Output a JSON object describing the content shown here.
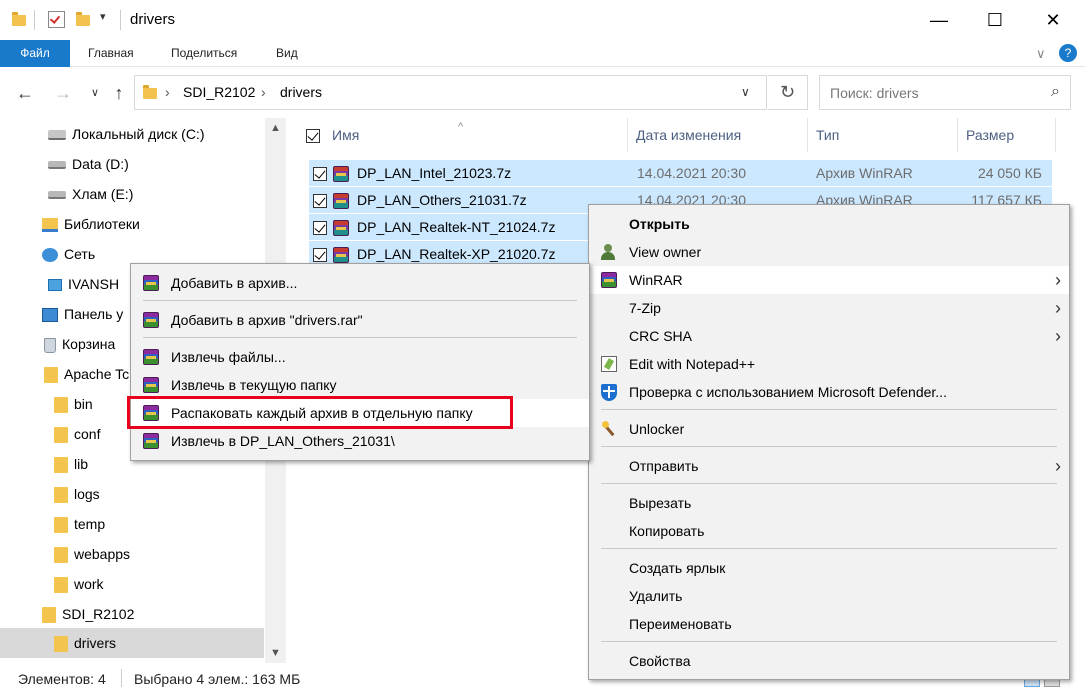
{
  "window": {
    "title": "drivers",
    "minimize_glyph": "—",
    "maximize_glyph": "☐",
    "close_glyph": "✕"
  },
  "ribbon": {
    "tabs": [
      "Файл",
      "Главная",
      "Поделиться",
      "Вид"
    ],
    "help_glyph": "?"
  },
  "address": {
    "crumbs": [
      "SDI_R2102",
      "drivers"
    ],
    "search_placeholder": "Поиск: drivers"
  },
  "nav_pane": {
    "items": [
      {
        "label": "Локальный диск (C:)",
        "icon": "drive-icon"
      },
      {
        "label": "Data (D:)",
        "icon": "drive-icon"
      },
      {
        "label": "Хлам (E:)",
        "icon": "drive-icon"
      },
      {
        "label": "Библиотеки",
        "icon": "library-icon"
      },
      {
        "label": "Сеть",
        "icon": "network-icon"
      },
      {
        "label": "IVANSH",
        "icon": "computer-icon"
      },
      {
        "label": "Панель у",
        "icon": "control-panel-icon"
      },
      {
        "label": "Корзина",
        "icon": "recycle-bin-icon"
      },
      {
        "label": "Apache Tc",
        "icon": "folder-icon"
      },
      {
        "label": "bin",
        "icon": "folder-icon"
      },
      {
        "label": "conf",
        "icon": "folder-icon"
      },
      {
        "label": "lib",
        "icon": "folder-icon"
      },
      {
        "label": "logs",
        "icon": "folder-icon"
      },
      {
        "label": "temp",
        "icon": "folder-icon"
      },
      {
        "label": "webapps",
        "icon": "folder-icon"
      },
      {
        "label": "work",
        "icon": "folder-icon"
      },
      {
        "label": "SDI_R2102",
        "icon": "folder-icon"
      },
      {
        "label": "drivers",
        "icon": "folder-icon",
        "selected": true
      }
    ]
  },
  "file_list": {
    "columns": [
      "Имя",
      "Дата изменения",
      "Тип",
      "Размер"
    ],
    "files": [
      {
        "name": "DP_LAN_Intel_21023.7z",
        "date": "14.04.2021 20:30",
        "type": "Архив WinRAR",
        "size": "24 050 КБ"
      },
      {
        "name": "DP_LAN_Others_21031.7z",
        "date": "14.04.2021 20:30",
        "type": "Архив WinRAR",
        "size": "117 657 КБ"
      },
      {
        "name": "DP_LAN_Realtek-NT_21024.7z",
        "date": "",
        "type": "",
        "size": ""
      },
      {
        "name": "DP_LAN_Realtek-XP_21020.7z",
        "date": "",
        "type": "",
        "size": ""
      }
    ]
  },
  "status": {
    "items_count": "Элементов: 4",
    "selected": "Выбрано 4 элем.: 163 МБ"
  },
  "context_menu": {
    "items": [
      "Открыть",
      "View owner",
      "WinRAR",
      "7-Zip",
      "CRC SHA",
      "Edit with Notepad++",
      "Проверка с использованием Microsoft Defender...",
      "Unlocker",
      "Отправить",
      "Вырезать",
      "Копировать",
      "Создать ярлык",
      "Удалить",
      "Переименовать",
      "Свойства"
    ]
  },
  "winrar_submenu": {
    "items": [
      "Добавить в архив...",
      "Добавить в архив \"drivers.rar\"",
      "Извлечь файлы...",
      "Извлечь в текущую папку",
      "Распаковать каждый архив в отдельную папку",
      "Извлечь в DP_LAN_Others_21031\\"
    ],
    "highlighted_index": 4
  },
  "colors": {
    "accent": "#1979ca",
    "selection": "#cce8ff",
    "highlight_border": "#e8001c"
  }
}
